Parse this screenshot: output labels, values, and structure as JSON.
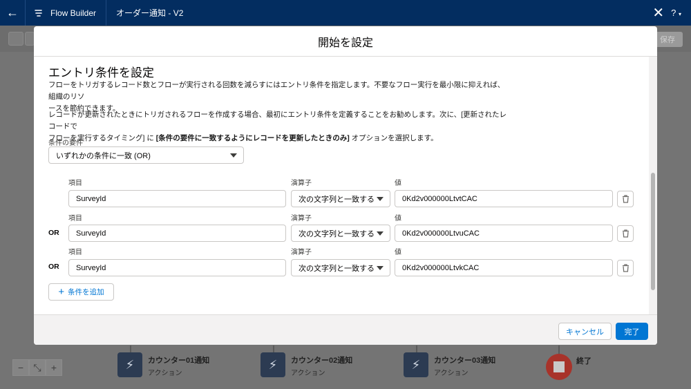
{
  "app": {
    "name": "Flow Builder",
    "flow_title": "オーダー通知 - V2",
    "help": "?"
  },
  "canvas": {
    "save_label": "保存",
    "zoom": [
      "−",
      "⤡",
      "+"
    ],
    "nodes": [
      {
        "name": "カウンター01通知",
        "type": "アクション"
      },
      {
        "name": "カウンター02通知",
        "type": "アクション"
      },
      {
        "name": "カウンター03通知",
        "type": "アクション"
      }
    ],
    "end_label": "終了"
  },
  "modal": {
    "title": "開始を設定",
    "section_title": "エントリ条件を設定",
    "desc1_line1": "フローをトリガするレコード数とフローが実行される回数を減らすにはエントリ条件を指定します。不要なフロー実行を最小限に抑えれば、組織のリソ",
    "desc1_line2": "ースを節約できます。",
    "desc2_line1": "レコードが更新されたときにトリガされるフローを作成する場合、最初にエントリ条件を定義することをお勧めします。次に、[更新されたレコードで",
    "desc2_line2_pre": "フローを実行するタイミング] に ",
    "desc2_line2_bold": "[条件の要件に一致するようにレコードを更新したときのみ]",
    "desc2_line2_post": " オプションを選択します。",
    "requirement_label": "条件の要件",
    "requirement_value": "いずれかの条件に一致 (OR)",
    "field_label": "項目",
    "operator_label": "演算子",
    "value_label": "値",
    "conditions": [
      {
        "connector": "",
        "field": "SurveyId",
        "operator": "次の文字列と一致する",
        "value": "0Kd2v000000LtvtCAC"
      },
      {
        "connector": "OR",
        "field": "SurveyId",
        "operator": "次の文字列と一致する",
        "value": "0Kd2v000000LtvuCAC"
      },
      {
        "connector": "OR",
        "field": "SurveyId",
        "operator": "次の文字列と一致する",
        "value": "0Kd2v000000LtvkCAC"
      }
    ],
    "add_condition": "条件を追加",
    "cancel": "キャンセル",
    "done": "完了"
  }
}
